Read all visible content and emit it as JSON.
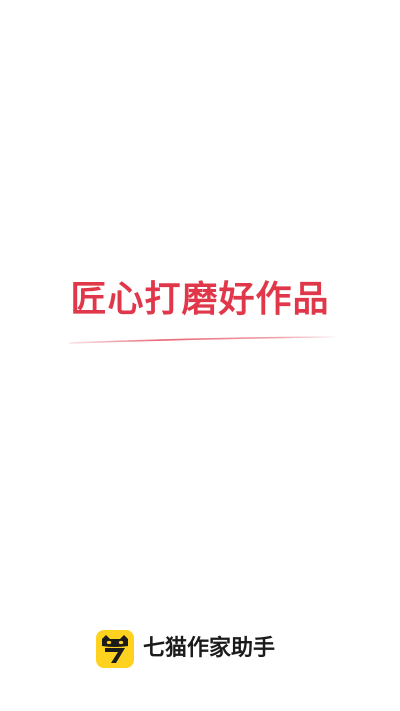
{
  "splash": {
    "slogan": "匠心打磨好作品",
    "slogan_color": "#e0384a"
  },
  "brand": {
    "logo_icon": "qimao-cat-7-logo-icon",
    "logo_color": "#ffd21f",
    "name": "七猫作家助手"
  }
}
